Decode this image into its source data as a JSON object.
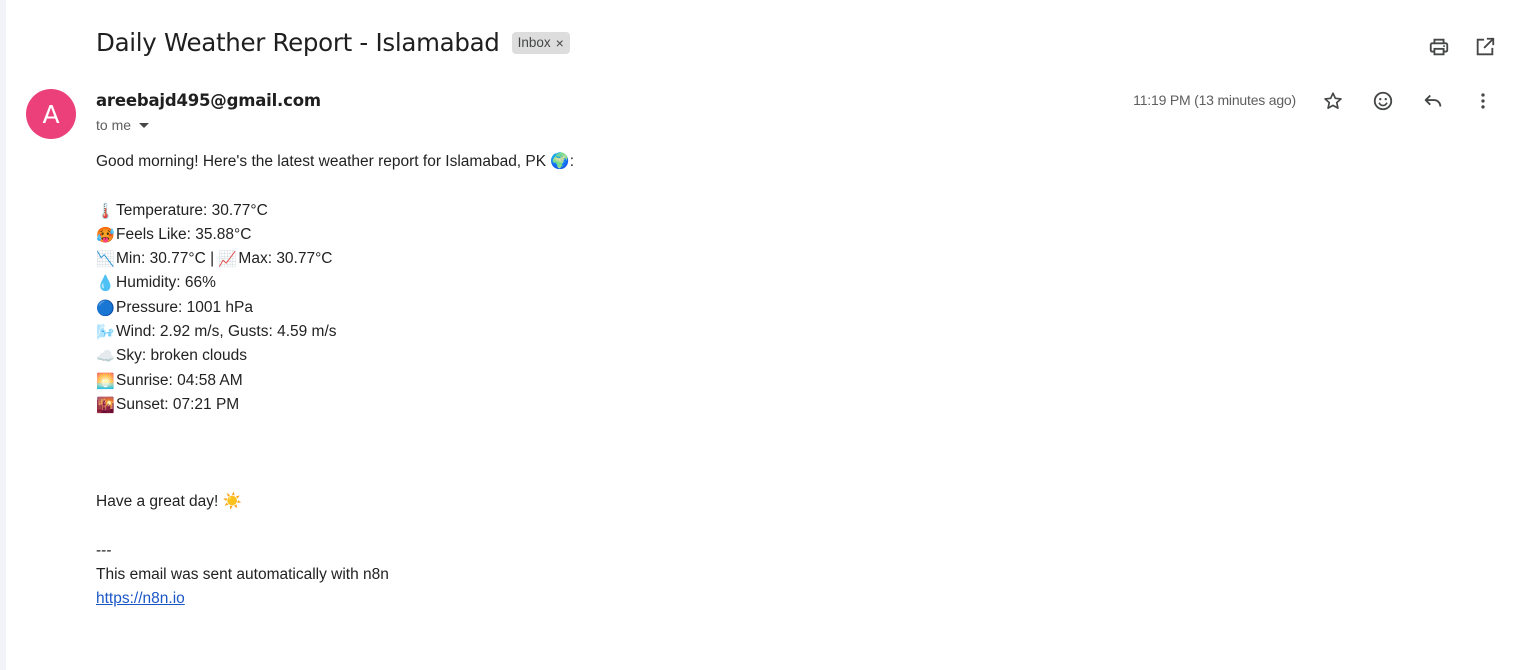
{
  "email": {
    "subject": "Daily Weather Report - Islamabad",
    "label": "Inbox",
    "label_remove": "×",
    "avatar_letter": "A",
    "sender": "areebajd495@gmail.com",
    "recipient": "to me",
    "timestamp": "11:19 PM (13 minutes ago)",
    "body": {
      "greeting_text": "Good morning! Here's the latest weather report for Islamabad, PK",
      "greeting_emoji": "🌍",
      "greeting_suffix": ":",
      "lines": [
        {
          "emoji": "🌡️",
          "text": "Temperature: 30.77°C"
        },
        {
          "emoji": "🥵",
          "text": "Feels Like: 35.88°C"
        },
        {
          "emoji": "📉",
          "text": "Min: 30.77°C | ",
          "emoji2": "📈",
          "text2": "Max: 30.77°C"
        },
        {
          "emoji": "💧",
          "text": "Humidity: 66%"
        },
        {
          "emoji": "🔵",
          "text": "Pressure: 1001 hPa"
        },
        {
          "emoji": "🌬️",
          "text": "Wind: 2.92 m/s, Gusts: 4.59 m/s"
        },
        {
          "emoji": "☁️",
          "text": "Sky: broken clouds"
        },
        {
          "emoji": "🌅",
          "text": "Sunrise: 04:58 AM"
        },
        {
          "emoji": "🌇",
          "text": "Sunset: 07:21 PM"
        }
      ],
      "closing_text": "Have a great day!",
      "closing_emoji": "☀️",
      "separator": "---",
      "footer": "This email was sent automatically with n8n",
      "link": "https://n8n.io"
    }
  },
  "icons": {
    "print": "printer-icon",
    "new_window": "open-in-new-window-icon",
    "star": "star-icon",
    "emoji_react": "smiley-icon",
    "reply": "reply-icon",
    "more": "more-vert-icon"
  },
  "colors": {
    "avatar_bg": "#ec407a",
    "label_bg": "#dddddd",
    "link": "#1a57c6"
  }
}
